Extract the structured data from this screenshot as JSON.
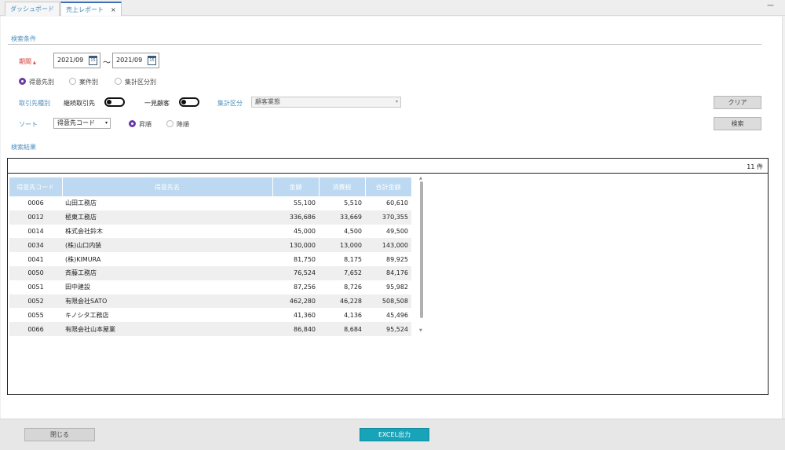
{
  "tabs": [
    {
      "label": "ダッシュボード"
    },
    {
      "label": "売上レポート",
      "close": "×"
    }
  ],
  "window": {
    "minimize": "—"
  },
  "search": {
    "section_title": "検索条件",
    "period_label": "期間",
    "required_mark": "▲",
    "date_from": "2021/09",
    "date_to": "2021/09",
    "date_sep": "～",
    "calendar_day": "15",
    "group_options": [
      {
        "label": "得意先別",
        "selected": true
      },
      {
        "label": "案件別",
        "selected": false
      },
      {
        "label": "集計区分別",
        "selected": false
      }
    ],
    "partner_type_label": "取引先種別",
    "continuing_label": "継続取引先",
    "oneoff_label": "一見顧客",
    "category_label": "集計区分",
    "category_value": "顧客業態",
    "sort_label": "ソート",
    "sort_value": "得意先コード",
    "order_options": [
      {
        "label": "昇順",
        "selected": true
      },
      {
        "label": "降順",
        "selected": false
      }
    ],
    "clear_button": "クリア",
    "search_button": "検索"
  },
  "results": {
    "section_title": "検索結果",
    "count": "11 件",
    "columns": [
      "得意先コード",
      "得意先名",
      "金額",
      "消費税",
      "合計金額"
    ],
    "rows": [
      [
        "0006",
        "山田工務店",
        "55,100",
        "5,510",
        "60,610"
      ],
      [
        "0012",
        "極東工務店",
        "336,686",
        "33,669",
        "370,355"
      ],
      [
        "0014",
        "株式会社鈴木",
        "45,000",
        "4,500",
        "49,500"
      ],
      [
        "0034",
        "(株)山口内装",
        "130,000",
        "13,000",
        "143,000"
      ],
      [
        "0041",
        "(株)KIMURA",
        "81,750",
        "8,175",
        "89,925"
      ],
      [
        "0050",
        "斉藤工務店",
        "76,524",
        "7,652",
        "84,176"
      ],
      [
        "0051",
        "田中建設",
        "87,256",
        "8,726",
        "95,982"
      ],
      [
        "0052",
        "有限会社SATO",
        "462,280",
        "46,228",
        "508,508"
      ],
      [
        "0055",
        "キノシタ工務店",
        "41,360",
        "4,136",
        "45,496"
      ],
      [
        "0066",
        "有限会社山本屋業",
        "86,840",
        "8,684",
        "95,524"
      ]
    ]
  },
  "footer": {
    "close_button": "閉じる",
    "excel_button": "EXCEL出力"
  },
  "colors": {
    "accent": "#4a8fc0",
    "header_bg": "#bcd9f1",
    "excel": "#17a3b8",
    "radio_on": "#6a3aa8",
    "required": "#d93b3b"
  }
}
